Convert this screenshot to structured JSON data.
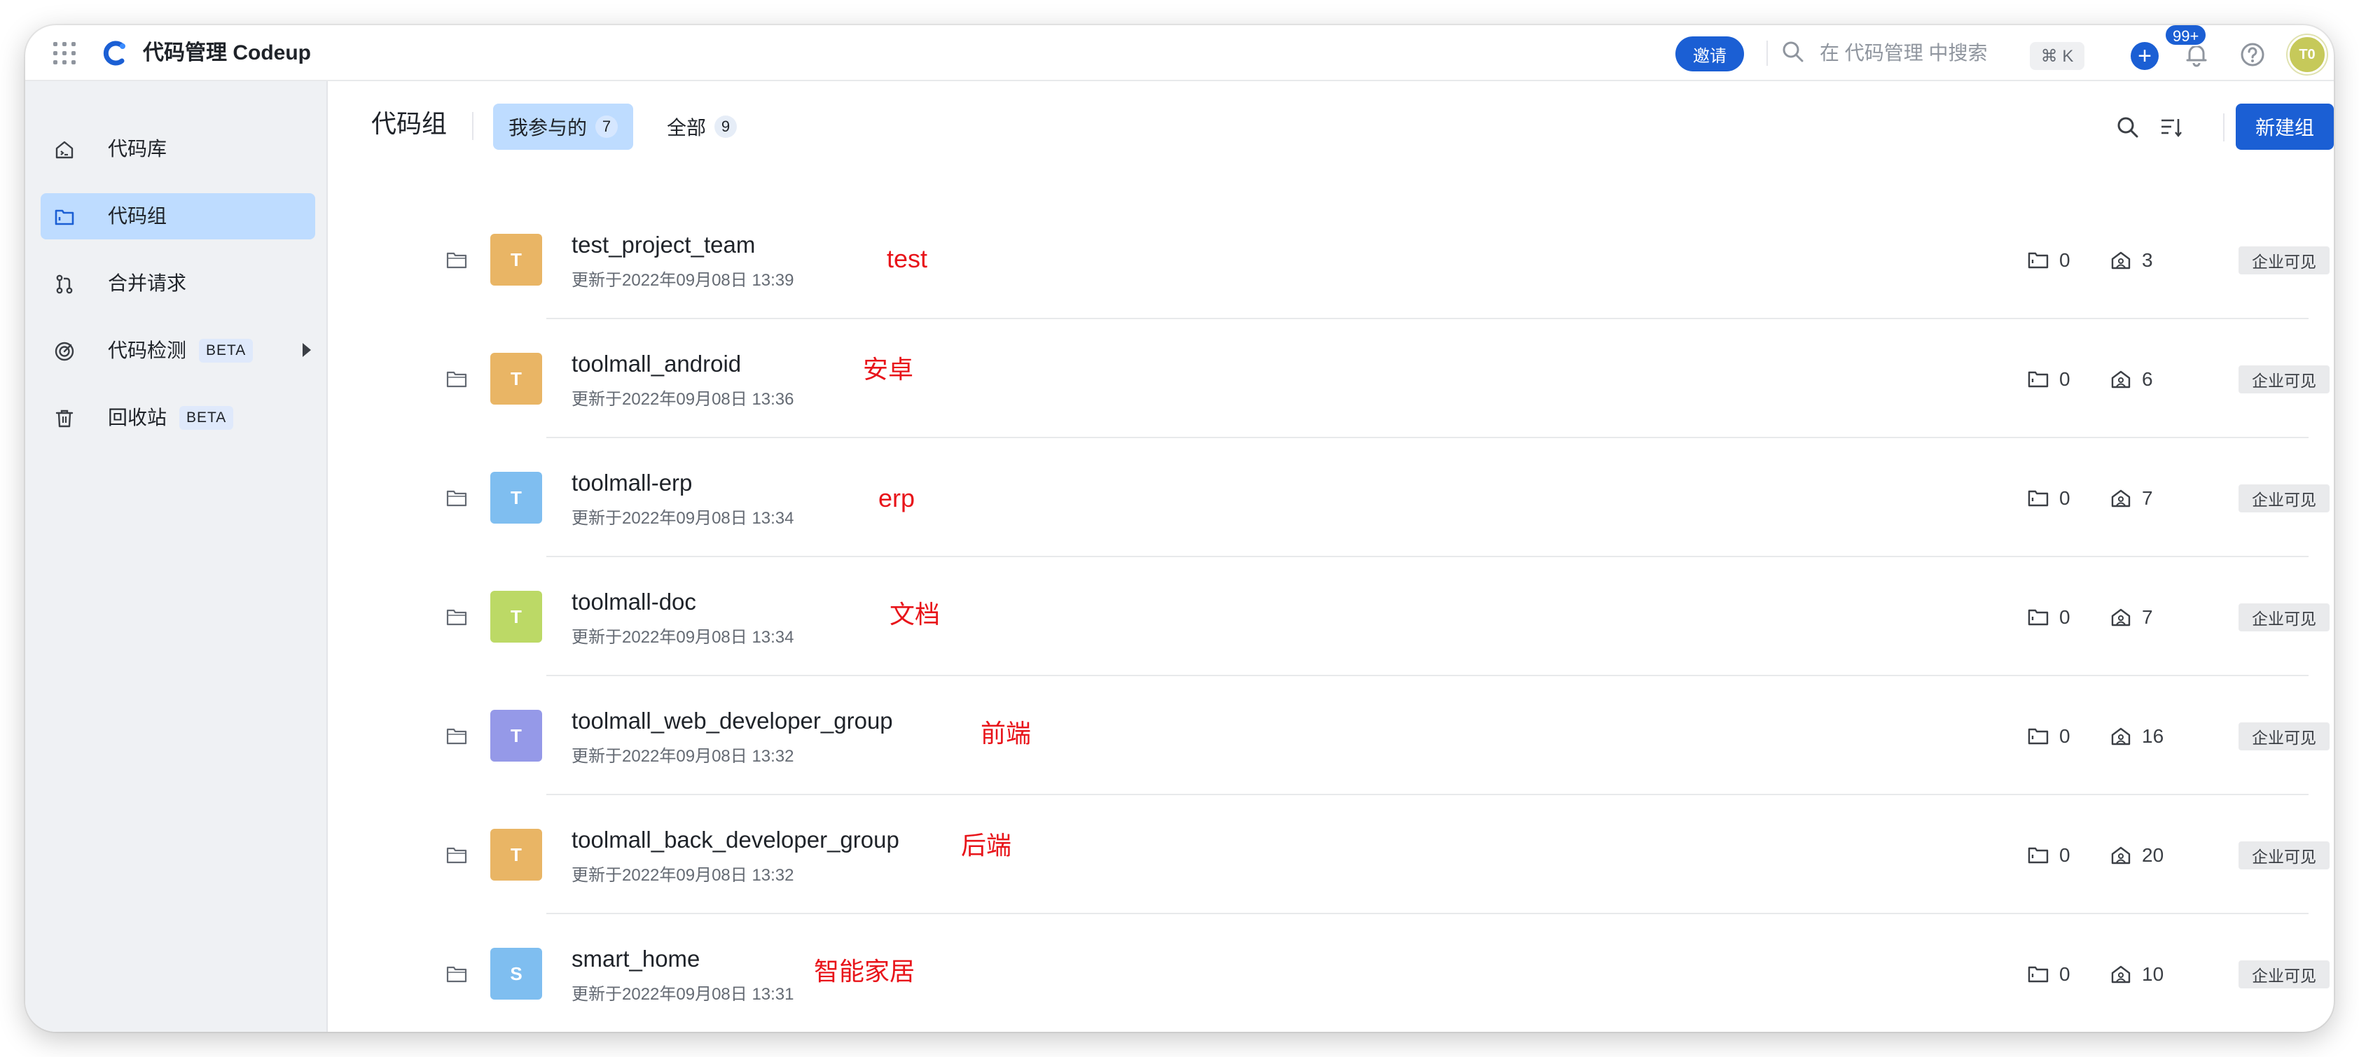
{
  "app": {
    "title": "代码管理 Codeup"
  },
  "topbar": {
    "invite_label": "邀请",
    "search_placeholder": "在 代码管理 中搜索",
    "shortcut": "⌘ K",
    "plus_label": "+",
    "notifications_badge": "99+",
    "user_initials": "T0"
  },
  "sidebar": {
    "items": [
      {
        "label": "代码库",
        "icon": "repo-home-icon",
        "active": false
      },
      {
        "label": "代码组",
        "icon": "folder-icon",
        "active": true
      },
      {
        "label": "合并请求",
        "icon": "merge-request-icon",
        "active": false
      },
      {
        "label": "代码检测",
        "icon": "scan-icon",
        "active": false,
        "badge": "BETA"
      },
      {
        "label": "回收站",
        "icon": "trash-icon",
        "active": false,
        "badge": "BETA"
      }
    ]
  },
  "main": {
    "title": "代码组",
    "tabs": [
      {
        "label": "我参与的",
        "count": "7",
        "active": true
      },
      {
        "label": "全部",
        "count": "9",
        "active": false
      }
    ],
    "new_group_label": "新建组"
  },
  "groups": [
    {
      "initial": "T",
      "color": "#e9b565",
      "name": "test_project_team",
      "updated": "更新于2022年09月08日 13:39",
      "note": "test",
      "repos": "0",
      "members": "3",
      "visibility": "企业可见"
    },
    {
      "initial": "T",
      "color": "#e9b565",
      "name": "toolmall_android",
      "updated": "更新于2022年09月08日 13:36",
      "note": "安卓",
      "repos": "0",
      "members": "6",
      "visibility": "企业可见"
    },
    {
      "initial": "T",
      "color": "#7fbef0",
      "name": "toolmall-erp",
      "updated": "更新于2022年09月08日 13:34",
      "note": "erp",
      "repos": "0",
      "members": "7",
      "visibility": "企业可见"
    },
    {
      "initial": "T",
      "color": "#bcd966",
      "name": "toolmall-doc",
      "updated": "更新于2022年09月08日 13:34",
      "note": "文档",
      "repos": "0",
      "members": "7",
      "visibility": "企业可见"
    },
    {
      "initial": "T",
      "color": "#9599e8",
      "name": "toolmall_web_developer_group",
      "updated": "更新于2022年09月08日 13:32",
      "note": "前端",
      "repos": "0",
      "members": "16",
      "visibility": "企业可见"
    },
    {
      "initial": "T",
      "color": "#e9b565",
      "name": "toolmall_back_developer_group",
      "updated": "更新于2022年09月08日 13:32",
      "note": "后端",
      "repos": "0",
      "members": "20",
      "visibility": "企业可见"
    },
    {
      "initial": "S",
      "color": "#7fbef0",
      "name": "smart_home",
      "updated": "更新于2022年09月08日 13:31",
      "note": "智能家居",
      "repos": "0",
      "members": "10",
      "visibility": "企业可见"
    }
  ]
}
